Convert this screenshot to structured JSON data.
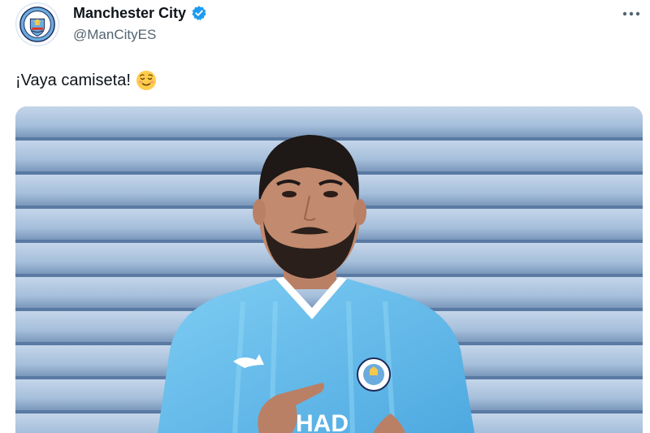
{
  "account": {
    "display_name": "Manchester City",
    "handle": "@ManCityES",
    "avatar_icon": "man-city-crest",
    "verified_icon": "verified-badge-icon",
    "verified_color": "#1d9bf0"
  },
  "menu": {
    "icon": "more-options-icon"
  },
  "tweet": {
    "text": "¡Vaya camiseta!",
    "emoji": "relieved-face"
  },
  "media": {
    "kit_sponsor_text": "HAD",
    "colors": {
      "shutter": "#a9c2dd",
      "shirt": "#6cc2ee",
      "trim": "#ffffff"
    }
  }
}
